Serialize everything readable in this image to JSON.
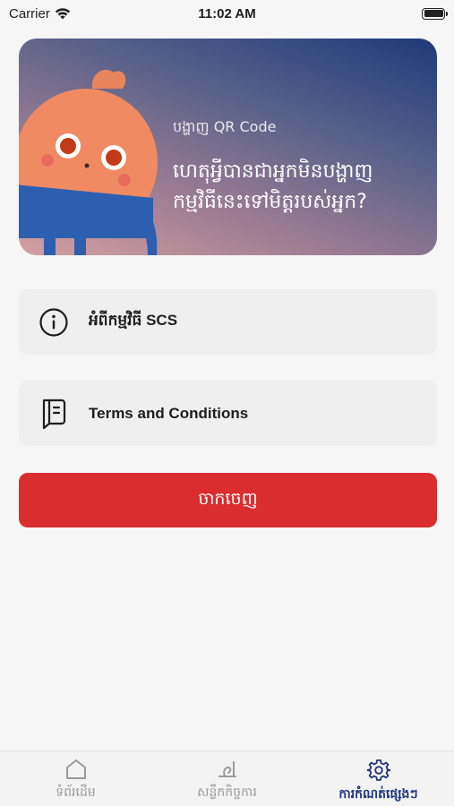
{
  "status_bar": {
    "carrier": "Carrier",
    "time": "11:02 AM",
    "battery_level": 1.0
  },
  "banner": {
    "subtitle": "បង្ហាញ QR Code",
    "title_line1": "ហេតុអ្វីបានជាអ្នកមិនបង្ហាញ",
    "title_line2": "កម្មវិធីនេះទៅមិត្តរបស់អ្នក?",
    "gradient_top": "#1f3b78",
    "gradient_bottom": "#d5a0a1"
  },
  "menu": {
    "items": [
      {
        "label": "អំពីកម្មវិធី SCS",
        "icon": "info-icon"
      },
      {
        "label": "Terms and Conditions",
        "icon": "notebook-icon"
      }
    ]
  },
  "logout": {
    "label": "ចាកចេញ",
    "color": "#d92d2f"
  },
  "tabs": [
    {
      "label": "ទំព័រដើម",
      "icon": "home-icon",
      "active": false
    },
    {
      "label": "សន្លឹកកិច្ចការ",
      "icon": "task-icon",
      "active": false
    },
    {
      "label": "ការកំណត់ផ្សេងៗ",
      "icon": "gear-icon",
      "active": true
    }
  ],
  "colors": {
    "accent": "#20357a",
    "inactive": "#9a9a9a"
  }
}
